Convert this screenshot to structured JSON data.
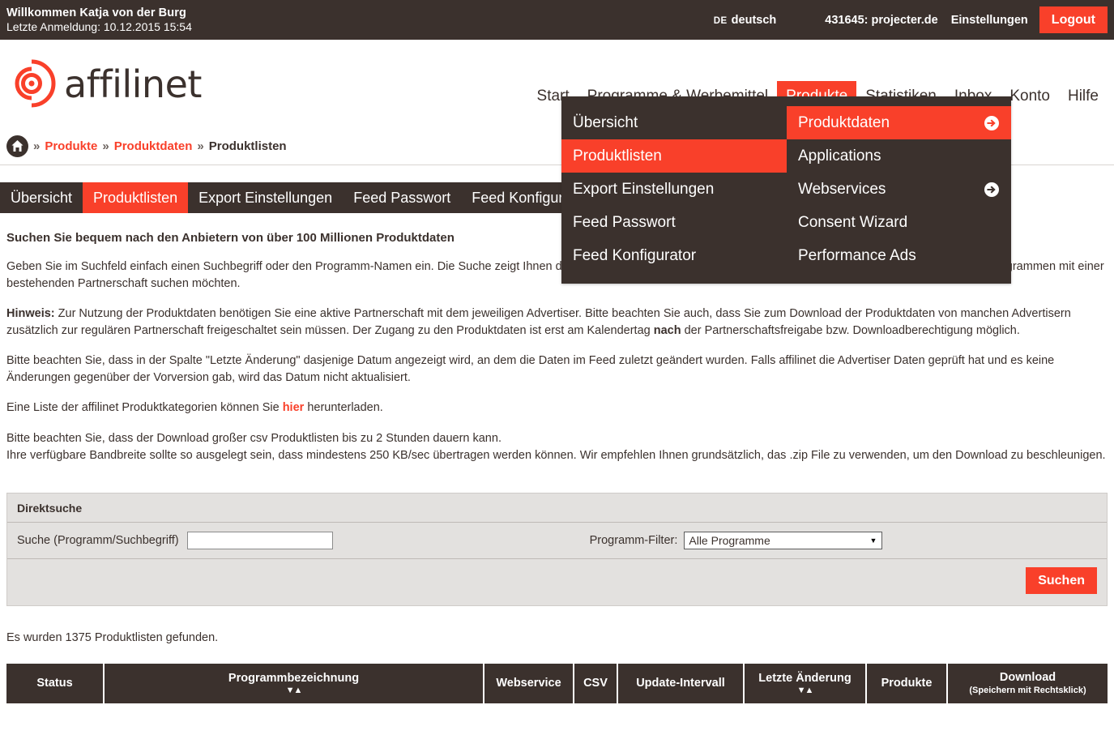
{
  "topbar": {
    "welcome": "Willkommen Katja von der Burg",
    "last_login": "Letzte Anmeldung: 10.12.2015 15:54",
    "lang_code": "DE",
    "lang_name": "deutsch",
    "account": "431645: projecter.de",
    "settings": "Einstellungen",
    "logout": "Logout"
  },
  "brand": {
    "name": "affilinet",
    "accent": "#f9402a",
    "dark": "#3b312d"
  },
  "mainnav": {
    "items": [
      {
        "label": "Start",
        "active": false
      },
      {
        "label": "Programme & Werbemittel",
        "active": false
      },
      {
        "label": "Produkte",
        "active": true
      },
      {
        "label": "Statistiken",
        "active": false
      },
      {
        "label": "Inbox",
        "active": false
      },
      {
        "label": "Konto",
        "active": false
      },
      {
        "label": "Hilfe",
        "active": false
      }
    ]
  },
  "dropdown": {
    "left": [
      {
        "label": "Übersicht",
        "selected": false,
        "arrow": false
      },
      {
        "label": "Produktlisten",
        "selected": true,
        "arrow": false
      },
      {
        "label": "Export Einstellungen",
        "selected": false,
        "arrow": false
      },
      {
        "label": "Feed Passwort",
        "selected": false,
        "arrow": false
      },
      {
        "label": "Feed Konfigurator",
        "selected": false,
        "arrow": false
      }
    ],
    "right": [
      {
        "label": "Produktdaten",
        "selected": true,
        "arrow": true
      },
      {
        "label": "Applications",
        "selected": false,
        "arrow": false
      },
      {
        "label": "Webservices",
        "selected": false,
        "arrow": true
      },
      {
        "label": "Consent Wizard",
        "selected": false,
        "arrow": false
      },
      {
        "label": "Performance Ads",
        "selected": false,
        "arrow": false
      }
    ]
  },
  "breadcrumb": {
    "home_icon": "home-icon",
    "sep": "»",
    "items": [
      {
        "label": "Produkte",
        "link": true
      },
      {
        "label": "Produktdaten",
        "link": true
      },
      {
        "label": "Produktlisten",
        "link": false
      }
    ]
  },
  "subtabs": [
    {
      "label": "Übersicht",
      "active": false
    },
    {
      "label": "Produktlisten",
      "active": true
    },
    {
      "label": "Export Einstellungen",
      "active": false
    },
    {
      "label": "Feed Passwort",
      "active": false
    },
    {
      "label": "Feed Konfigurator",
      "active": false
    }
  ],
  "content": {
    "lead_title": "Suchen Sie bequem nach den Anbietern von über 100 Millionen Produktdaten",
    "p1": "Geben Sie im Suchfeld einfach einen Suchbegriff oder den Programm-Namen ein. Die Suche zeigt Ihnen dann alle passenden Ergebnisse an. Zusätzlich können Sie filtern, ob Sie nur nach Programmen mit einer bestehenden Partnerschaft suchen möchten.",
    "p2_label": "Hinweis:",
    "p2_a": " Zur Nutzung der Produktdaten benötigen Sie eine aktive Partnerschaft mit dem jeweiligen Advertiser. Bitte beachten Sie auch, dass Sie zum Download der Produktdaten von manchen Advertisern zusätzlich zur regulären Partnerschaft freigeschaltet sein müssen. Der Zugang zu den Produktdaten ist erst am Kalendertag ",
    "p2_bold": "nach",
    "p2_b": " der Partnerschaftsfreigabe bzw. Downloadberechtigung möglich.",
    "p3": "Bitte beachten Sie, dass in der Spalte \"Letzte Änderung\" dasjenige Datum angezeigt wird, an dem die Daten im Feed zuletzt geändert wurden. Falls affilinet die Advertiser Daten geprüft hat und es keine Änderungen gegenüber der Vorversion gab, wird das Datum nicht aktualisiert.",
    "p4_a": "Eine Liste der affilinet Produktkategorien können Sie ",
    "p4_link": "hier",
    "p4_b": " herunterladen.",
    "p5_line1": "Bitte beachten Sie, dass der Download großer csv Produktlisten bis zu 2 Stunden dauern kann.",
    "p5_line2": "Ihre verfügbare Bandbreite sollte so ausgelegt sein, dass mindestens 250 KB/sec übertragen werden können. Wir empfehlen Ihnen grundsätzlich, das .zip File zu verwenden, um den Download zu beschleunigen."
  },
  "search_panel": {
    "title": "Direktsuche",
    "search_label": "Suche (Programm/Suchbegriff)",
    "search_value": "",
    "search_placeholder": "",
    "filter_label": "Programm-Filter:",
    "filter_value": "Alle Programme",
    "filter_caret": "▼",
    "submit_label": "Suchen"
  },
  "results": {
    "count_text": "Es wurden 1375 Produktlisten gefunden."
  },
  "table": {
    "columns": [
      {
        "label": "Status",
        "sortable": false,
        "note": ""
      },
      {
        "label": "Programmbezeichnung",
        "sortable": true,
        "note": ""
      },
      {
        "label": "Webservice",
        "sortable": false,
        "note": ""
      },
      {
        "label": "CSV",
        "sortable": false,
        "note": ""
      },
      {
        "label": "Update-Intervall",
        "sortable": false,
        "note": ""
      },
      {
        "label": "Letzte Änderung",
        "sortable": true,
        "note": ""
      },
      {
        "label": "Produkte",
        "sortable": false,
        "note": ""
      },
      {
        "label": "Download",
        "sortable": false,
        "note": "(Speichern mit Rechtsklick)"
      }
    ],
    "sort_arrows": "▼▲"
  }
}
